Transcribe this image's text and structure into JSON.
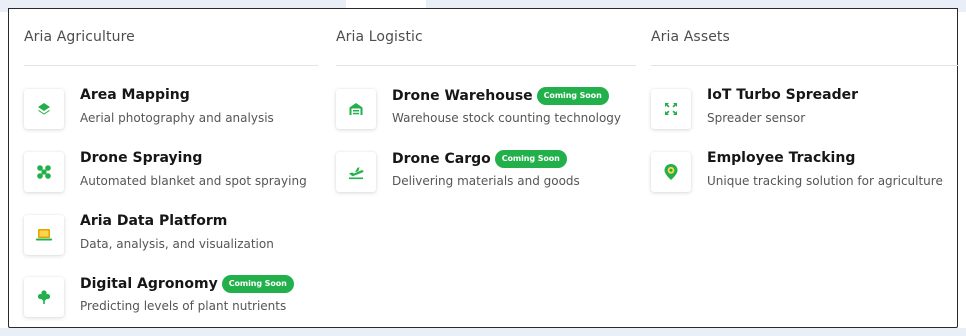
{
  "colors": {
    "accent": "#22b04b",
    "heading": "#4d4d4d",
    "title": "#161616",
    "desc": "#555555"
  },
  "columns": [
    {
      "heading": "Aria Agriculture",
      "items": [
        {
          "title": "Area Mapping",
          "desc": "Aerial photography and analysis",
          "badge": "",
          "icon": "layers-icon"
        },
        {
          "title": "Drone Spraying",
          "desc": "Automated blanket and spot spraying",
          "badge": "",
          "icon": "drone-icon"
        },
        {
          "title": "Aria Data Platform",
          "desc": "Data, analysis, and visualization",
          "badge": "",
          "icon": "laptop-icon"
        },
        {
          "title": "Digital Agronomy",
          "desc": "Predicting levels of plant nutrients",
          "badge": "Coming Soon",
          "icon": "sprout-icon"
        }
      ]
    },
    {
      "heading": "Aria Logistic",
      "items": [
        {
          "title": "Drone Warehouse",
          "desc": "Warehouse stock counting technology",
          "badge": "Coming Soon",
          "icon": "warehouse-icon"
        },
        {
          "title": "Drone Cargo",
          "desc": "Delivering materials and goods",
          "badge": "Coming Soon",
          "icon": "plane-departure-icon"
        }
      ]
    },
    {
      "heading": "Aria Assets",
      "items": [
        {
          "title": "IoT Turbo Spreader",
          "desc": "Spreader sensor",
          "badge": "",
          "icon": "expand-arrows-icon"
        },
        {
          "title": "Employee Tracking",
          "desc": "Unique tracking solution for agriculture",
          "badge": "",
          "icon": "location-pin-icon"
        }
      ]
    }
  ]
}
